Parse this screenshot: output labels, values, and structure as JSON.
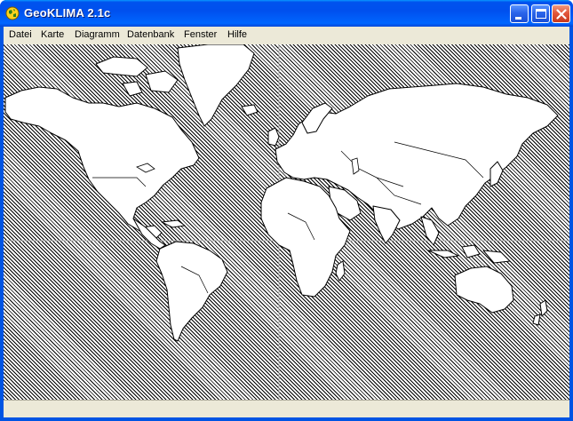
{
  "window": {
    "title": "GeoKLIMA 2.1c",
    "icon": "globe-icon"
  },
  "titlebar_buttons": {
    "minimize": "minimize-icon",
    "maximize": "maximize-icon",
    "close": "close-icon"
  },
  "menu": {
    "items": [
      {
        "label": "Datei"
      },
      {
        "label": "Karte"
      },
      {
        "label": "Diagramm"
      },
      {
        "label": "Datenbank"
      },
      {
        "label": "Fenster"
      },
      {
        "label": "Hilfe"
      }
    ]
  },
  "map": {
    "background_pattern": "diagonal-hatch",
    "land_color": "#ffffff",
    "outline_color": "#000000",
    "graticule_color": "#b0b0b0"
  },
  "colors": {
    "titlebar_blue": "#0054e3",
    "close_red": "#e2583c",
    "menu_bg": "#ece9d8"
  }
}
